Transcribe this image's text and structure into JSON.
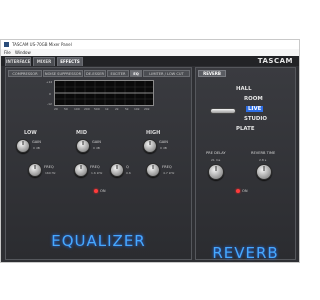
{
  "window": {
    "title": "TASCAM US-70GB Mixer Panel",
    "menu": [
      "File",
      "Window"
    ]
  },
  "app": {
    "brand": "TASCAM",
    "top_tabs": [
      "INTERFACE",
      "MIXER",
      "EFFECTS"
    ],
    "active_top_tab": "EFFECTS"
  },
  "eq": {
    "sub_tabs": [
      "COMPRESSOR",
      "NOISE SUPPRESSOR",
      "DE-ESSER",
      "EXCITER",
      "EQ",
      "LIMITER / LOW CUT"
    ],
    "active_sub_tab": "EQ",
    "graph": {
      "freq_labels": [
        "20",
        "50",
        "100",
        "200",
        "500",
        "1k",
        "2k",
        "5k",
        "10k",
        "20k"
      ],
      "db_labels": [
        "+12",
        "0",
        "-12"
      ]
    },
    "bands": {
      "low": {
        "title": "LOW",
        "gain_label": "GAIN",
        "gain_value": "0 dB",
        "freq_label": "FREQ",
        "freq_value": "160 Hz"
      },
      "mid": {
        "title": "MID",
        "gain_label": "GAIN",
        "gain_value": "0 dB",
        "freq_label": "FREQ",
        "freq_value": "1.6 kHz",
        "q_label": "Q",
        "q_value": "0.6"
      },
      "high": {
        "title": "HIGH",
        "gain_label": "GAIN",
        "gain_value": "0 dB",
        "freq_label": "FREQ",
        "freq_value": "4.7 kHz"
      }
    },
    "on_label": "ON",
    "section_title": "EQUALIZER",
    "led_color": "#ff3b3b"
  },
  "reverb": {
    "tab": "REVERB",
    "types": [
      "HALL",
      "ROOM",
      "LIVE",
      "STUDIO",
      "PLATE"
    ],
    "selected_type": "LIVE",
    "pre_delay_label": "PRE DELAY",
    "pre_delay_value": "21 ms",
    "reverb_time_label": "REVERB TIME",
    "reverb_time_value": "2.8 s",
    "on_label": "ON",
    "section_title": "REVERB"
  },
  "colors": {
    "accent_blue": "#46a8ff",
    "panel_bg": "#2e2f33",
    "selected_bg": "#2f6fe6"
  }
}
